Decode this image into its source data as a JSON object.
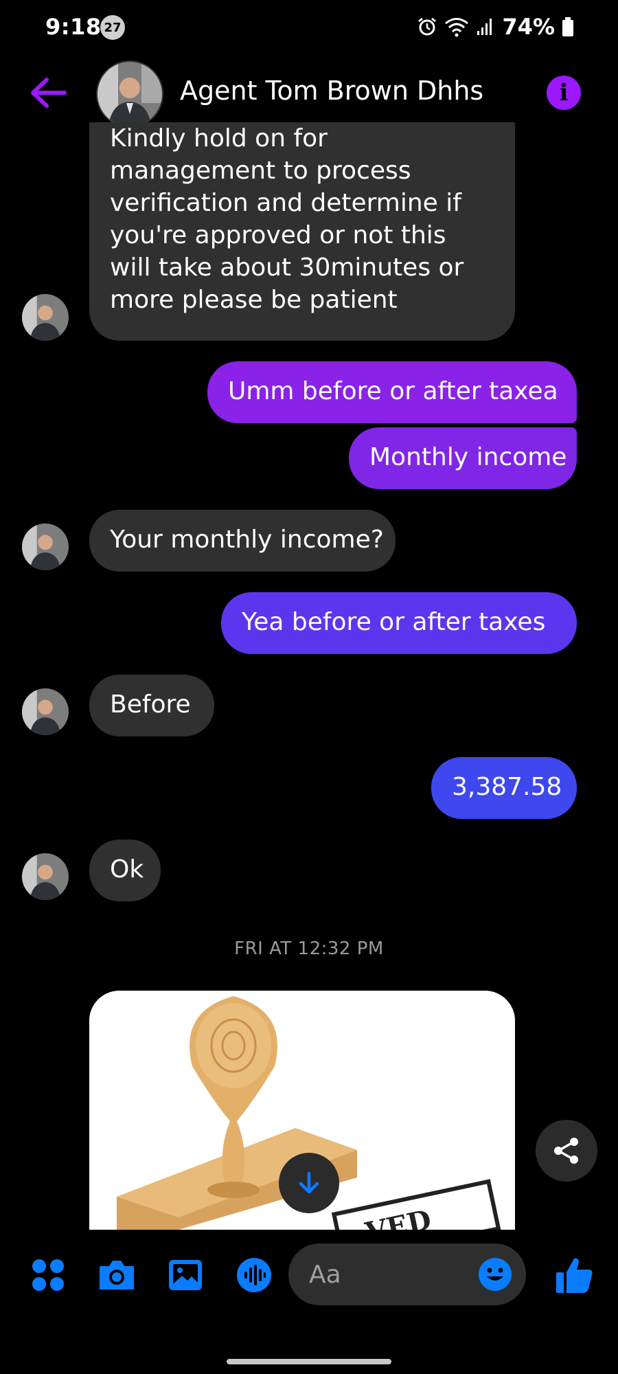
{
  "status_bar": {
    "time": "9:18",
    "notification_count": "27",
    "battery": "74%"
  },
  "header": {
    "contact_name": "Agent Tom Brown Dhhs"
  },
  "messages": [
    {
      "side": "in",
      "text": "Kindly hold on for management to process verification and determine if you're approved or not this will take about 30minutes or more please be patient"
    },
    {
      "side": "out",
      "text": "Umm before or after taxea",
      "color": "#8a22e8"
    },
    {
      "side": "out",
      "text": "Monthly income",
      "color": "#8026e6"
    },
    {
      "side": "in",
      "text": "Your monthly income?"
    },
    {
      "side": "out",
      "text": "Yea before or after taxes",
      "color": "#5a37ee"
    },
    {
      "side": "in",
      "text": "Before"
    },
    {
      "side": "out",
      "text": "3,387.58",
      "color": "#3e48ee"
    },
    {
      "side": "in",
      "text": "Ok"
    }
  ],
  "timestamp": "FRI AT 12:32 PM",
  "image_message": {
    "icon": "stamp-image"
  },
  "composer": {
    "placeholder": "Aa"
  },
  "colors": {
    "accent_purple": "#9b18ff",
    "accent_blue": "#0a7cff"
  }
}
